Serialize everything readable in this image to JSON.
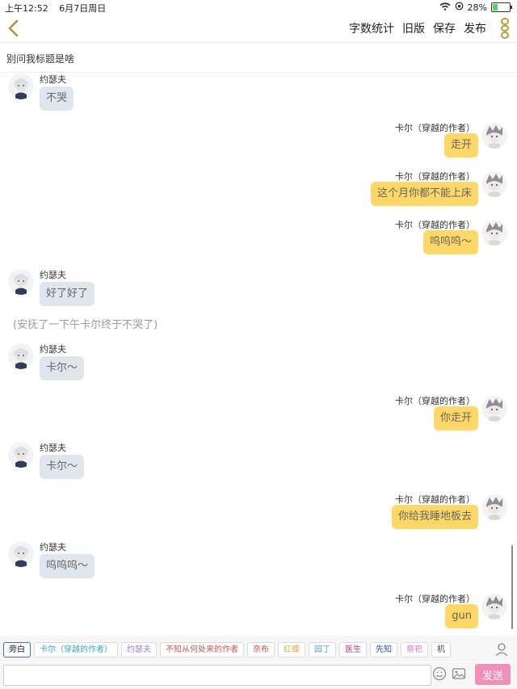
{
  "status": {
    "time": "上午12:52",
    "date": "6月7日周日",
    "battery": "28%",
    "battery_level": 0.28
  },
  "nav": {
    "actions": [
      "字数统计",
      "旧版",
      "保存",
      "发布"
    ]
  },
  "title": "别问我标题是啥",
  "messages": [
    {
      "type": "left",
      "name": "约瑟夫",
      "text": "不哭"
    },
    {
      "type": "right",
      "name": "卡尔（穿越的作者）",
      "text": "走开"
    },
    {
      "type": "right",
      "name": "卡尔（穿越的作者）",
      "text": "这个月你都不能上床"
    },
    {
      "type": "right",
      "name": "卡尔（穿越的作者）",
      "text": "呜呜呜～"
    },
    {
      "type": "left",
      "name": "约瑟夫",
      "text": "好了好了"
    },
    {
      "type": "narration",
      "text": "(安抚了一下午卡尔终于不哭了)"
    },
    {
      "type": "left",
      "name": "约瑟夫",
      "text": "卡尔～"
    },
    {
      "type": "right",
      "name": "卡尔（穿越的作者）",
      "text": "你走开"
    },
    {
      "type": "left",
      "name": "约瑟夫",
      "text": "卡尔～"
    },
    {
      "type": "right",
      "name": "卡尔（穿越的作者）",
      "text": "你给我睡地板去"
    },
    {
      "type": "left",
      "name": "约瑟夫",
      "text": "呜呜呜～"
    },
    {
      "type": "right",
      "name": "卡尔（穿越的作者）",
      "text": "gun"
    }
  ],
  "roles": [
    {
      "label": "旁白",
      "color": "#222222"
    },
    {
      "label": "卡尔（穿越的作者）",
      "color": "#3aa6c9"
    },
    {
      "label": "约瑟夫",
      "color": "#a77bd6"
    },
    {
      "label": "不知从何处来的作者",
      "color": "#d9534f"
    },
    {
      "label": "奈布",
      "color": "#d9534f"
    },
    {
      "label": "红蝶",
      "color": "#e6a64b"
    },
    {
      "label": "园丁",
      "color": "#5aa6c9"
    },
    {
      "label": "医生",
      "color": "#c0398a"
    },
    {
      "label": "先知",
      "color": "#2b4f9e"
    },
    {
      "label": "祭祀",
      "color": "#e07ad0"
    },
    {
      "label": "机",
      "color": "#444444"
    }
  ],
  "input": {
    "value": "",
    "placeholder": ""
  },
  "send_label": "发送"
}
